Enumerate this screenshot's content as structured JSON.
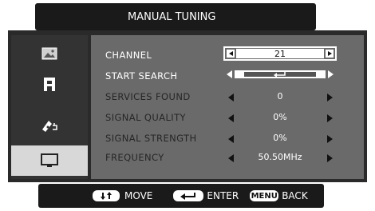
{
  "title": "MANUAL TUNING",
  "sidebar": {
    "items": [
      {
        "icon": "picture-icon"
      },
      {
        "icon": "audio-icon"
      },
      {
        "icon": "setup-icon"
      },
      {
        "icon": "monitor-icon"
      }
    ]
  },
  "rows": [
    {
      "label": "CHANNEL",
      "value": "21"
    },
    {
      "label": "START SEARCH",
      "value": ""
    },
    {
      "label": "SERVICES FOUND",
      "value": "0"
    },
    {
      "label": "SIGNAL QUALITY",
      "value": "0%"
    },
    {
      "label": "SIGNAL STRENGTH",
      "value": "0%"
    },
    {
      "label": "FREQUENCY",
      "value": "50.50MHz"
    }
  ],
  "hints": {
    "move": "MOVE",
    "enter": "ENTER",
    "menu_key": "MENU",
    "back": "BACK"
  },
  "colors": {
    "panel": "#2a2a2a",
    "content": "#6a6a6a",
    "active_sidebar": "#d8d8d8"
  }
}
